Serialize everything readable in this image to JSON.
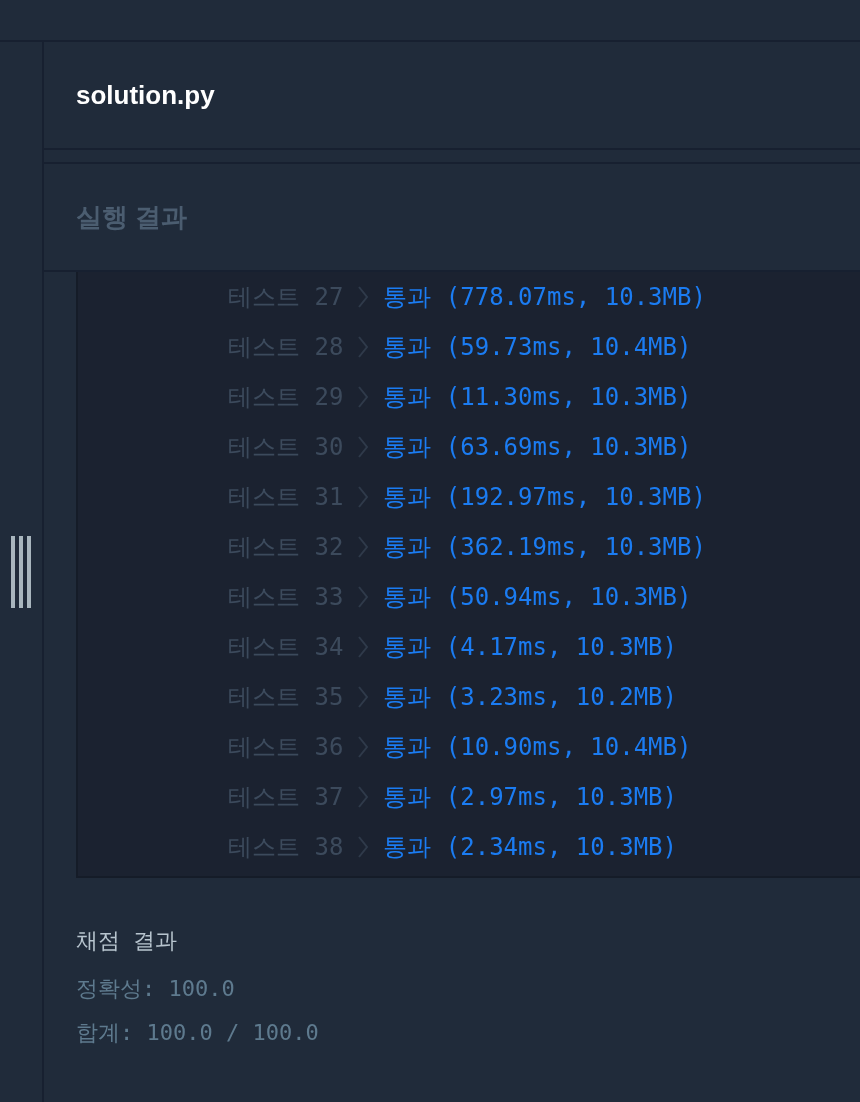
{
  "editor": {
    "filename": "solution.py"
  },
  "output": {
    "title": "실행 결과",
    "rows": [
      {
        "label": "테스트 27",
        "result": "통과 (778.07ms, 10.3MB)"
      },
      {
        "label": "테스트 28",
        "result": "통과 (59.73ms, 10.4MB)"
      },
      {
        "label": "테스트 29",
        "result": "통과 (11.30ms, 10.3MB)"
      },
      {
        "label": "테스트 30",
        "result": "통과 (63.69ms, 10.3MB)"
      },
      {
        "label": "테스트 31",
        "result": "통과 (192.97ms, 10.3MB)"
      },
      {
        "label": "테스트 32",
        "result": "통과 (362.19ms, 10.3MB)"
      },
      {
        "label": "테스트 33",
        "result": "통과 (50.94ms, 10.3MB)"
      },
      {
        "label": "테스트 34",
        "result": "통과 (4.17ms, 10.3MB)"
      },
      {
        "label": "테스트 35",
        "result": "통과 (3.23ms, 10.2MB)"
      },
      {
        "label": "테스트 36",
        "result": "통과 (10.90ms, 10.4MB)"
      },
      {
        "label": "테스트 37",
        "result": "통과 (2.97ms, 10.3MB)"
      },
      {
        "label": "테스트 38",
        "result": "통과 (2.34ms, 10.3MB)"
      }
    ]
  },
  "grading": {
    "title": "채점 결과",
    "lines": [
      "정확성: 100.0",
      "합계: 100.0 / 100.0"
    ]
  }
}
